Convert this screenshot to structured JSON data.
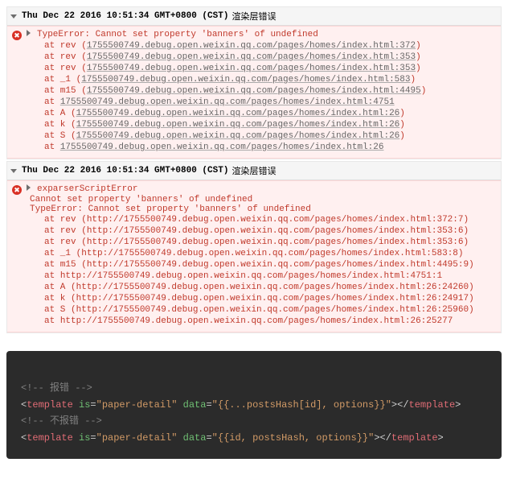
{
  "groups": [
    {
      "timestamp": "Thu Dec 22 2016 10:51:34 GMT+0800 (CST)",
      "suffix": "渲染层错误",
      "expanded": true,
      "error": {
        "title": "TypeError: Cannot set property 'banners' of undefined",
        "messages": [],
        "trace": [
          {
            "label": "at rev ",
            "open": "(",
            "link": "1755500749.debug.open.weixin.qq.com/pages/homes/index.html:372",
            "close": ")"
          },
          {
            "label": "at rev ",
            "open": "(",
            "link": "1755500749.debug.open.weixin.qq.com/pages/homes/index.html:353",
            "close": ")"
          },
          {
            "label": "at rev ",
            "open": "(",
            "link": "1755500749.debug.open.weixin.qq.com/pages/homes/index.html:353",
            "close": ")"
          },
          {
            "label": "at _1 ",
            "open": "(",
            "link": "1755500749.debug.open.weixin.qq.com/pages/homes/index.html:583",
            "close": ")"
          },
          {
            "label": "at m15 ",
            "open": "(",
            "link": "1755500749.debug.open.weixin.qq.com/pages/homes/index.html:4495",
            "close": ")"
          },
          {
            "label": "at ",
            "open": "",
            "link": "1755500749.debug.open.weixin.qq.com/pages/homes/index.html:4751",
            "close": ""
          },
          {
            "label": "at A ",
            "open": "(",
            "link": "1755500749.debug.open.weixin.qq.com/pages/homes/index.html:26",
            "close": ")"
          },
          {
            "label": "at k ",
            "open": "(",
            "link": "1755500749.debug.open.weixin.qq.com/pages/homes/index.html:26",
            "close": ")"
          },
          {
            "label": "at S ",
            "open": "(",
            "link": "1755500749.debug.open.weixin.qq.com/pages/homes/index.html:26",
            "close": ")"
          },
          {
            "label": "at ",
            "open": "",
            "link": "1755500749.debug.open.weixin.qq.com/pages/homes/index.html:26",
            "close": ""
          }
        ]
      }
    },
    {
      "timestamp": "Thu Dec 22 2016 10:51:34 GMT+0800 (CST)",
      "suffix": "渲染层错误",
      "expanded": true,
      "error": {
        "title": "exparserScriptError",
        "messages": [
          "Cannot set property 'banners' of undefined",
          "TypeError: Cannot set property 'banners' of undefined"
        ],
        "trace": [
          {
            "label": "at rev ",
            "open": "(",
            "link": "http://1755500749.debug.open.weixin.qq.com/pages/homes/index.html:372:7",
            "close": ")",
            "plain": true
          },
          {
            "label": "at rev ",
            "open": "(",
            "link": "http://1755500749.debug.open.weixin.qq.com/pages/homes/index.html:353:6",
            "close": ")",
            "plain": true
          },
          {
            "label": "at rev ",
            "open": "(",
            "link": "http://1755500749.debug.open.weixin.qq.com/pages/homes/index.html:353:6",
            "close": ")",
            "plain": true
          },
          {
            "label": "at _1 ",
            "open": "(",
            "link": "http://1755500749.debug.open.weixin.qq.com/pages/homes/index.html:583:8",
            "close": ")",
            "plain": true
          },
          {
            "label": "at m15 ",
            "open": "(",
            "link": "http://1755500749.debug.open.weixin.qq.com/pages/homes/index.html:4495:9",
            "close": ")",
            "plain": true
          },
          {
            "label": "at ",
            "open": "",
            "link": "http://1755500749.debug.open.weixin.qq.com/pages/homes/index.html:4751:1",
            "close": "",
            "plain": true
          },
          {
            "label": "at A ",
            "open": "(",
            "link": "http://1755500749.debug.open.weixin.qq.com/pages/homes/index.html:26:24260",
            "close": ")",
            "plain": true
          },
          {
            "label": "at k ",
            "open": "(",
            "link": "http://1755500749.debug.open.weixin.qq.com/pages/homes/index.html:26:24917",
            "close": ")",
            "plain": true
          },
          {
            "label": "at S ",
            "open": "(",
            "link": "http://1755500749.debug.open.weixin.qq.com/pages/homes/index.html:26:25960",
            "close": ")",
            "plain": true
          },
          {
            "label": "at ",
            "open": "",
            "link": "http://1755500749.debug.open.weixin.qq.com/pages/homes/index.html:26:25277",
            "close": "",
            "plain": true
          }
        ]
      }
    }
  ],
  "code": {
    "comment1": "<!-- 报错 -->",
    "tagOpen": "<",
    "tagName": "template",
    "attrIs": "is",
    "valIs": "\"paper-detail\"",
    "attrData": "data",
    "valData1": "\"{{...postsHash[id], options}}\"",
    "closeEmpty": "></",
    "tagClose": ">",
    "comment2": "<!-- 不报错 -->",
    "valData2": "\"{{id, postsHash, options}}\""
  }
}
